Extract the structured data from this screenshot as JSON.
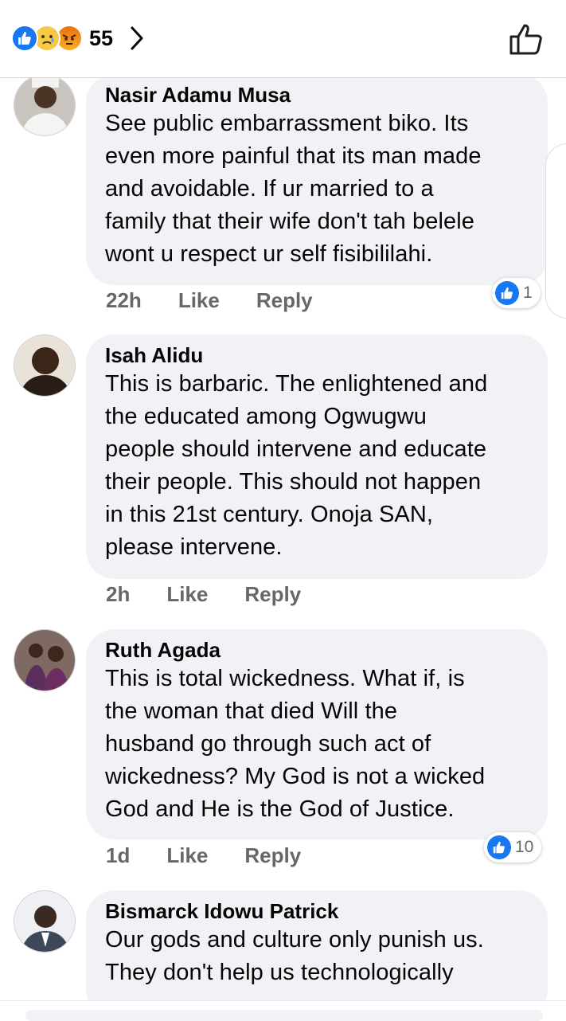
{
  "header": {
    "reaction_icons": [
      "like-reaction-icon",
      "sad-reaction-icon",
      "angry-reaction-icon"
    ],
    "reaction_count": "55",
    "like_button_icon": "thumbs-up-outline-icon"
  },
  "colors": {
    "accent": "#1877f2",
    "bubble": "#f0f2f5",
    "meta_text": "#65676b",
    "text": "#050505"
  },
  "comments": [
    {
      "author": "Nasir Adamu Musa",
      "lines": [
        "See public embarrassment biko. Its",
        "even more painful that its man made",
        "and avoidable. If ur married to a",
        "family that their wife don't tah belele",
        "wont u respect ur self fisibililahi."
      ],
      "time": "22h",
      "like_label": "Like",
      "reply_label": "Reply",
      "reaction_count": "1"
    },
    {
      "author": "Isah Alidu",
      "lines": [
        "This is barbaric. The enlightened and",
        "the educated among Ogwugwu",
        "people should intervene and educate",
        "their people. This should not happen",
        "in this 21st century. Onoja SAN,",
        "please intervene."
      ],
      "time": "2h",
      "like_label": "Like",
      "reply_label": "Reply"
    },
    {
      "author": "Ruth Agada",
      "lines": [
        "This is total wickedness. What if, is",
        "the woman that died Will the",
        "husband go through such act of",
        "wickedness? My God is not a wicked",
        "God and He is  the God of Justice."
      ],
      "time": "1d",
      "like_label": "Like",
      "reply_label": "Reply",
      "reaction_count": "10"
    },
    {
      "author": "Bismarck Idowu Patrick",
      "lines": [
        "Our gods and culture only punish us.",
        "They don't help us technologically"
      ]
    }
  ]
}
